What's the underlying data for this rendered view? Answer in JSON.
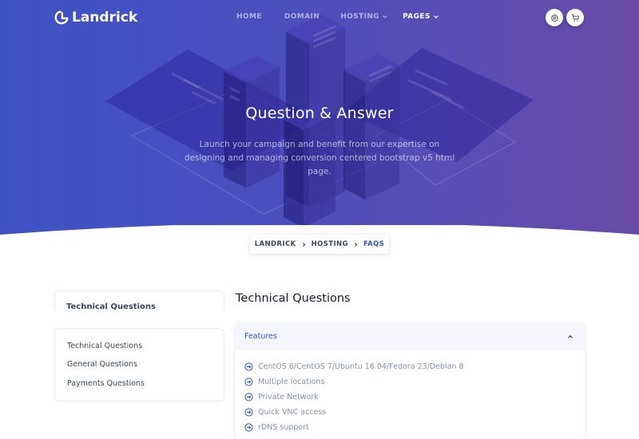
{
  "brand": {
    "name": "Landrick"
  },
  "nav": {
    "items": [
      {
        "label": "HOME"
      },
      {
        "label": "DOMAIN"
      },
      {
        "label": "HOSTING"
      },
      {
        "label": "PAGES"
      }
    ]
  },
  "hero": {
    "title": "Question & Answer",
    "subtitle": "Launch your campaign and benefit from our expertise on designing and managing conversion centered bootstrap v5 html page."
  },
  "breadcrumb": {
    "items": [
      {
        "label": "LANDRICK"
      },
      {
        "label": "HOSTING"
      },
      {
        "label": "FAQS"
      }
    ]
  },
  "sidebar": {
    "partial_title": "Technical Questions",
    "links": [
      {
        "label": "Technical Questions"
      },
      {
        "label": "General Questions"
      },
      {
        "label": "Payments Questions"
      }
    ]
  },
  "main": {
    "section_title": "Technical Questions",
    "accordion": {
      "title": "Features",
      "expanded": true,
      "items": [
        {
          "label": "CentOS 6/CentOS 7/Ubuntu 16.04/Fedora 23/Debian 8"
        },
        {
          "label": "Multiple locations"
        },
        {
          "label": "Private Network"
        },
        {
          "label": "Quick VNC access"
        },
        {
          "label": "rDNS support"
        }
      ]
    }
  },
  "icons": {
    "settings": "gear-icon",
    "cart": "shopping-cart-icon",
    "feature_bullet": "arrow-right-circle-icon",
    "accordion_toggle": "chevron-up-icon",
    "breadcrumb_separator": "chevron-right-icon"
  },
  "colors": {
    "hero_start": "#3f52c4",
    "hero_end": "#6a4ca7",
    "accent": "#2f55d4",
    "text_dark": "#161c2d",
    "text_muted": "#8492a6"
  }
}
